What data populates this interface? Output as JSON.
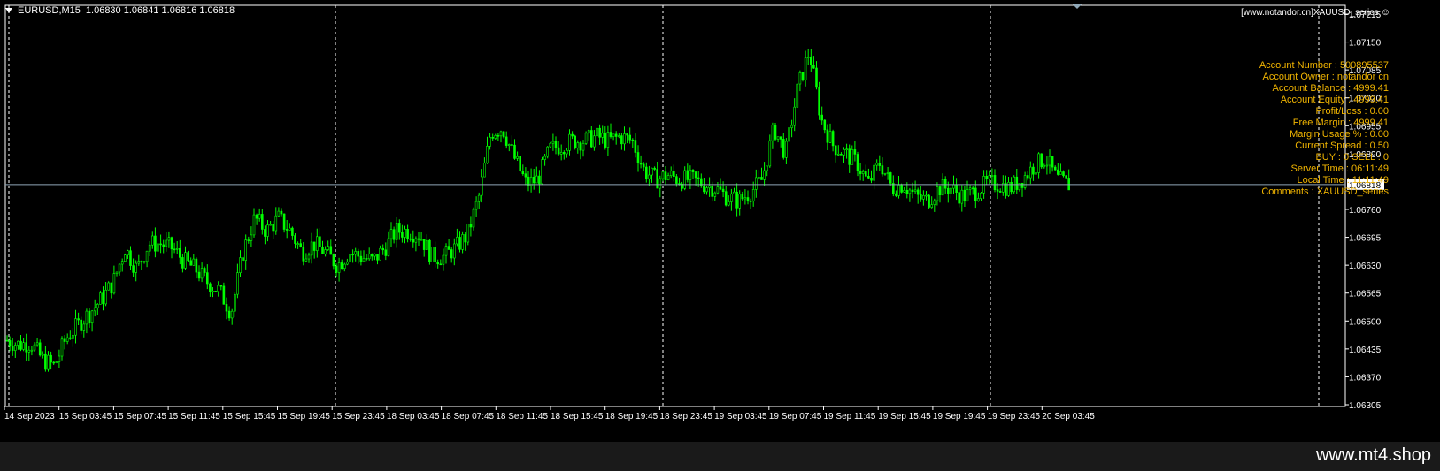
{
  "header": {
    "symbol": "EURUSD,M15",
    "ohlc": "1.06830 1.06841 1.06816 1.06818"
  },
  "expert_label": "[www.notandor.cn]XAUUSD_series",
  "expert_icon": "smiley-icon",
  "info_panel": [
    "Account Number : 500895537",
    "Account Owner : notandor cn",
    "Account Balance : 4999.41",
    "Account Equity : 4999.41",
    "Profit/Loss : 0.00",
    "Free Margin : 4999.41",
    "Margin Usage % : 0.00",
    "Current Spread : 0.50",
    "BUY : 0 SELL : 0",
    "Server Time : 06:11:49",
    "Local Time : 11:11:49",
    "Comments : XAUUSD_series"
  ],
  "watermark": "www.mt4.shop",
  "colors": {
    "background": "#000000",
    "candles": "#00ff00",
    "grid": "#ffffff",
    "info_text": "#f0b400",
    "price_line": "#8fa7b8"
  },
  "chart_data": {
    "type": "candlestick",
    "symbol": "EURUSD",
    "timeframe": "M15",
    "current_price": 1.06818,
    "ylim": [
      1.06305,
      1.07215
    ],
    "y_ticks": [
      1.07215,
      1.0715,
      1.07085,
      1.0702,
      1.06955,
      1.0689,
      1.06818,
      1.0676,
      1.06695,
      1.0663,
      1.06565,
      1.065,
      1.06435,
      1.0637,
      1.06305
    ],
    "y_tick_labels": [
      "1.07215",
      "1.07150",
      "1.07085",
      "1.07020",
      "1.06955",
      "1.06890",
      "1.06818",
      "1.06760",
      "1.06695",
      "1.06630",
      "1.06565",
      "1.06500",
      "1.06435",
      "1.06370",
      "1.06305"
    ],
    "x_tick_labels": [
      "14 Sep 2023",
      "15 Sep 03:45",
      "15 Sep 07:45",
      "15 Sep 11:45",
      "15 Sep 15:45",
      "15 Sep 19:45",
      "15 Sep 23:45",
      "18 Sep 03:45",
      "18 Sep 07:45",
      "18 Sep 11:45",
      "18 Sep 15:45",
      "18 Sep 19:45",
      "18 Sep 23:45",
      "19 Sep 03:45",
      "19 Sep 07:45",
      "19 Sep 11:45",
      "19 Sep 15:45",
      "19 Sep 19:45",
      "19 Sep 23:45",
      "20 Sep 03:45"
    ],
    "period_separators": [
      "15 Sep 00:00",
      "18 Sep 00:00",
      "19 Sep 00:00",
      "20 Sep 00:00"
    ],
    "price_path": [
      1.06455,
      1.06445,
      1.0645,
      1.0641,
      1.06395,
      1.0646,
      1.0649,
      1.0652,
      1.0655,
      1.0659,
      1.0667,
      1.0662,
      1.0668,
      1.0668,
      1.0667,
      1.0664,
      1.0662,
      1.0659,
      1.0657,
      1.0652,
      1.0666,
      1.0674,
      1.0671,
      1.0674,
      1.0671,
      1.0666,
      1.0668,
      1.0666,
      1.0663,
      1.0666,
      1.0665,
      1.0664,
      1.0667,
      1.0671,
      1.0671,
      1.067,
      1.0665,
      1.0665,
      1.0667,
      1.067,
      1.0679,
      1.0694,
      1.0695,
      1.0688,
      1.0682,
      1.0683,
      1.069,
      1.0691,
      1.0692,
      1.0692,
      1.0693,
      1.0692,
      1.0693,
      1.0692,
      1.0685,
      1.0683,
      1.0684,
      1.0683,
      1.0683,
      1.0682,
      1.0681,
      1.0679,
      1.0678,
      1.068,
      1.0683,
      1.0695,
      1.0689,
      1.0704,
      1.0713,
      1.0697,
      1.0691,
      1.0689,
      1.0687,
      1.0682,
      1.0687,
      1.0681,
      1.0682,
      1.0679,
      1.0678,
      1.0681,
      1.0681,
      1.0679,
      1.068,
      1.0682,
      1.0682,
      1.0681,
      1.0683,
      1.0686,
      1.0688,
      1.0683,
      1.06818
    ]
  }
}
